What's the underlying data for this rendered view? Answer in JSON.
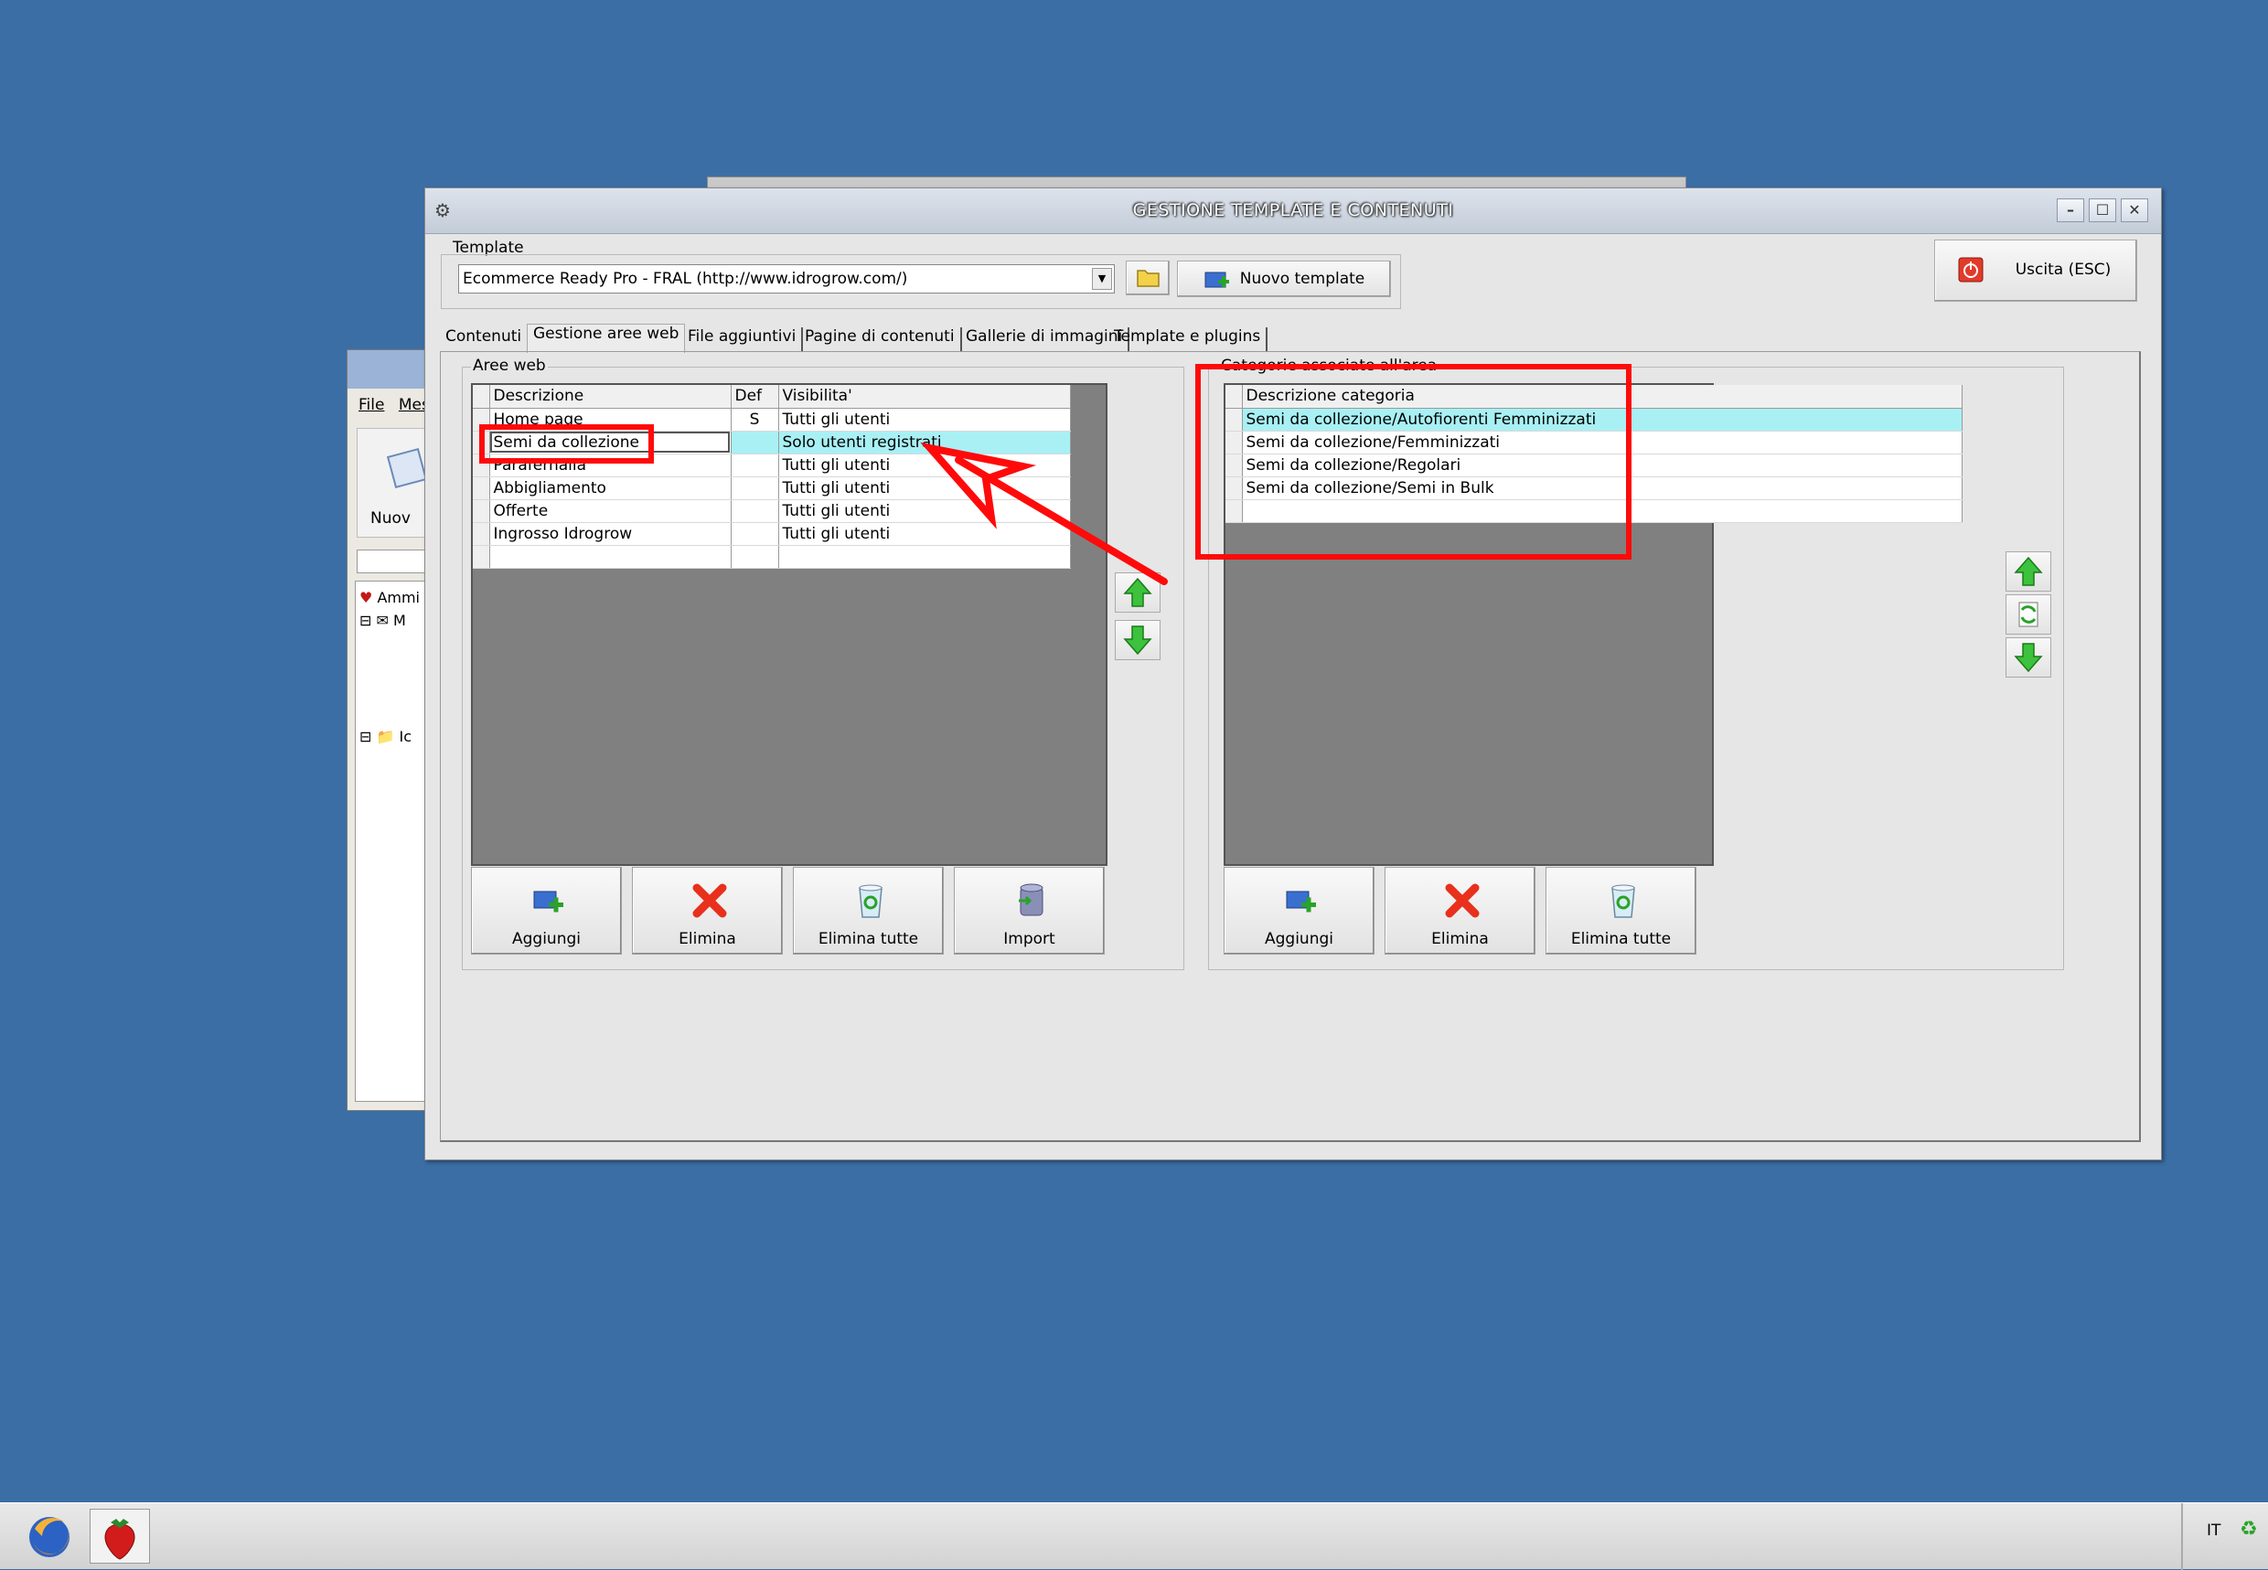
{
  "desktop": {
    "background": "#3b6ea5"
  },
  "background_window": {
    "menu": [
      "File",
      "Mes"
    ],
    "toolbar_label": "Nuov",
    "tree": [
      "Ammi",
      "M",
      "Ic"
    ]
  },
  "window": {
    "title": "GESTIONE TEMPLATE E CONTENUTI",
    "controls": {
      "minimize": "–",
      "maximize": "☐",
      "close": "✕"
    }
  },
  "template": {
    "label": "Template",
    "selected": "Ecommerce Ready Pro - FRAL (http://www.idrogrow.com/)",
    "new_button": "Nuovo template"
  },
  "exit_button": "Uscita (ESC)",
  "tabs": [
    {
      "label": "Contenuti",
      "active": false
    },
    {
      "label": "Gestione aree web",
      "active": true
    },
    {
      "label": "File aggiuntivi",
      "active": false
    },
    {
      "label": "Pagine di contenuti",
      "active": false
    },
    {
      "label": "Gallerie di immagini",
      "active": false
    },
    {
      "label": "Template e plugins",
      "active": false
    }
  ],
  "aree_web": {
    "group_label": "Aree web",
    "columns": [
      "Descrizione",
      "Def",
      "Visibilita'"
    ],
    "rows": [
      {
        "descrizione": "Home page",
        "def": "S",
        "visibilita": "Tutti gli utenti"
      },
      {
        "descrizione": "Semi da collezione",
        "def": "",
        "visibilita": "Solo utenti registrati"
      },
      {
        "descrizione": "Paraferhalia",
        "def": "",
        "visibilita": "Tutti gli utenti"
      },
      {
        "descrizione": "Abbigliamento",
        "def": "",
        "visibilita": "Tutti gli utenti"
      },
      {
        "descrizione": "Offerte",
        "def": "",
        "visibilita": "Tutti gli utenti"
      },
      {
        "descrizione": "Ingrosso Idrogrow",
        "def": "",
        "visibilita": "Tutti gli utenti"
      }
    ],
    "selected_index": 1,
    "buttons": {
      "add": "Aggiungi",
      "delete": "Elimina",
      "delete_all": "Elimina tutte",
      "import": "Import"
    }
  },
  "categorie": {
    "group_label": "Categorie associate all'area",
    "columns": [
      "Descrizione categoria"
    ],
    "rows": [
      "Semi da collezione/Autofiorenti Femminizzati",
      "Semi da collezione/Femminizzati",
      "Semi da collezione/Regolari",
      "Semi da collezione/Semi in Bulk"
    ],
    "selected_index": 0,
    "buttons": {
      "add": "Aggiungi",
      "delete": "Elimina",
      "delete_all": "Elimina tutte"
    }
  },
  "taskbar": {
    "language": "IT"
  },
  "annotation_color": "#ff0a0a",
  "selection_color": "#a8f0f4"
}
